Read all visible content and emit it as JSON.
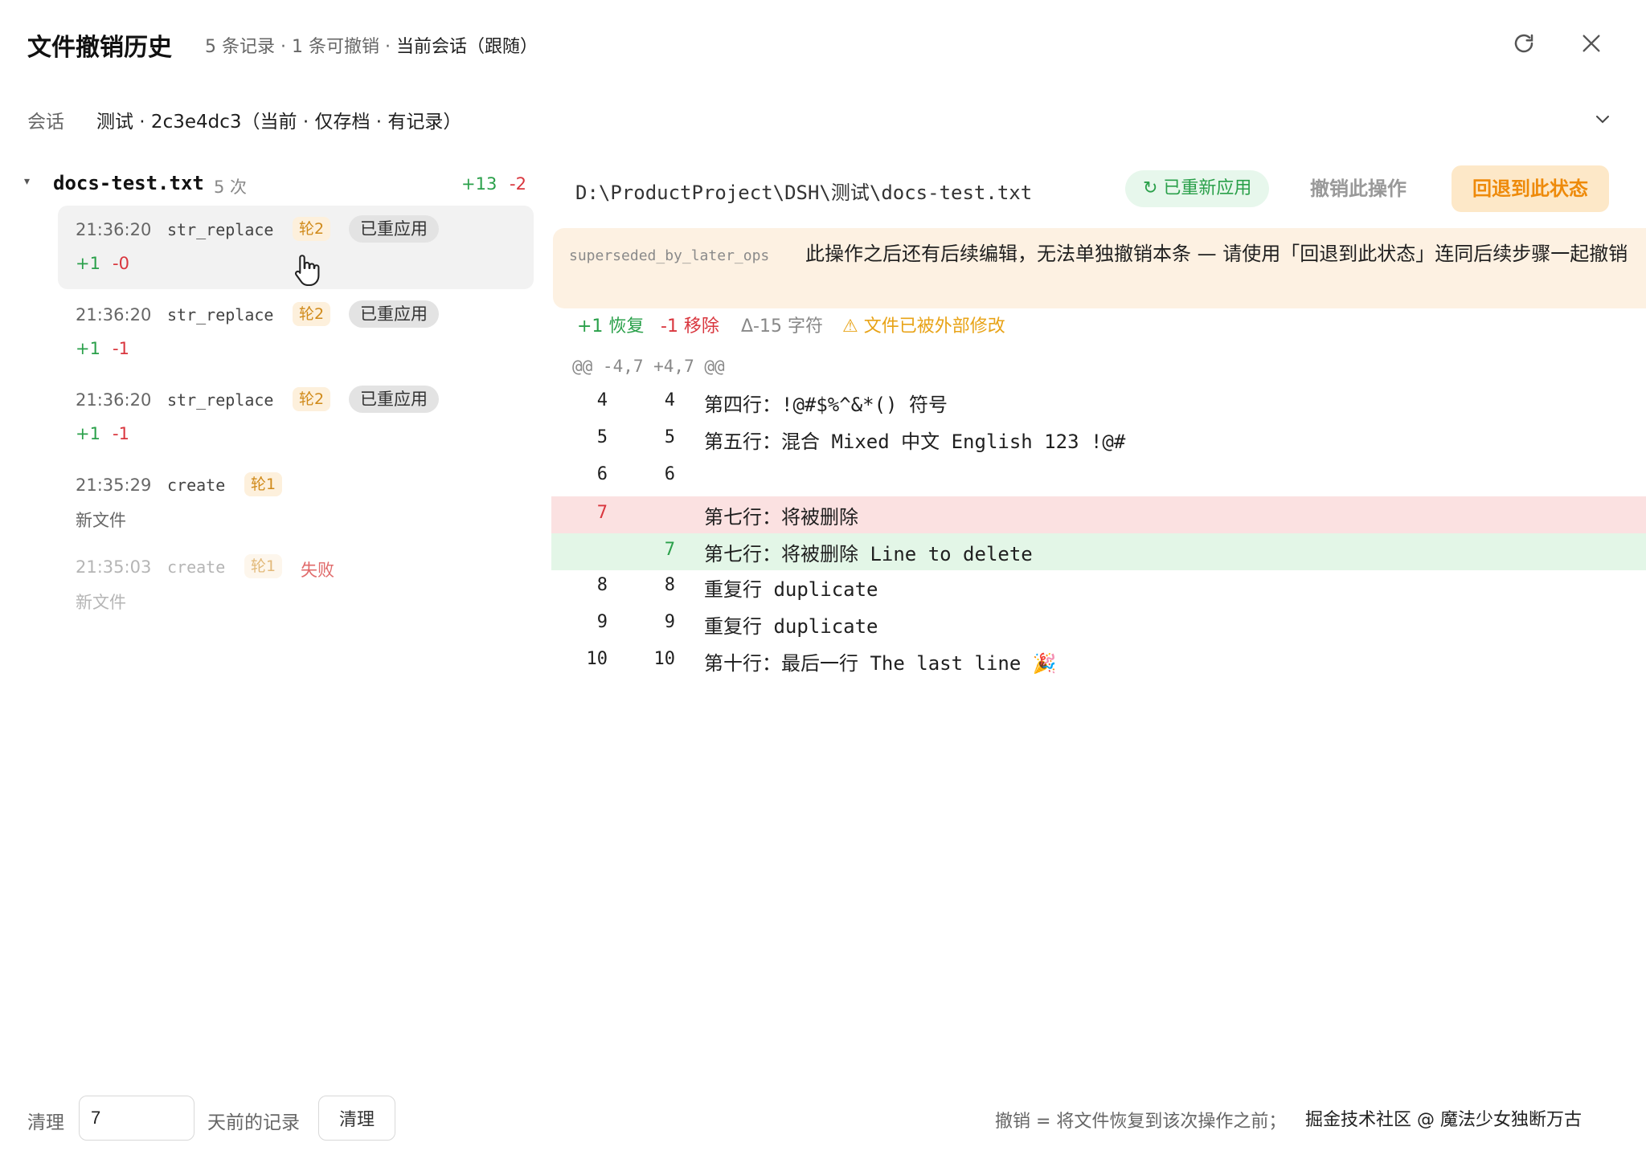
{
  "header": {
    "title": "文件撤销历史",
    "summary_plain": "5 条记录 · 1 条可撤销 · ",
    "summary_strong": "当前会话（跟随）",
    "refresh_icon": "refresh-icon",
    "close_icon": "close-icon"
  },
  "session": {
    "label": "会话",
    "value": "测试 · 2c3e4dc3（当前 · 仅存档 · 有记录）",
    "chevron_icon": "chevron-down-icon"
  },
  "file": {
    "name": "docs-test.txt",
    "count": "5 次",
    "added": "+13",
    "removed": "-2",
    "entries": [
      {
        "time": "21:36:20",
        "op": "str_replace",
        "round": "轮2",
        "status": "已重应用",
        "plus": "+1",
        "minus": "-0"
      },
      {
        "time": "21:36:20",
        "op": "str_replace",
        "round": "轮2",
        "status": "已重应用",
        "plus": "+1",
        "minus": "-1"
      },
      {
        "time": "21:36:20",
        "op": "str_replace",
        "round": "轮2",
        "status": "已重应用",
        "plus": "+1",
        "minus": "-1"
      },
      {
        "time": "21:35:29",
        "op": "create",
        "round": "轮1",
        "note": "新文件"
      },
      {
        "time": "21:35:03",
        "op": "create",
        "round": "轮1",
        "fail": "失败",
        "note": "新文件"
      }
    ]
  },
  "detail": {
    "path": "D:\\ProductProject\\DSH\\测试\\docs-test.txt",
    "reapplied_badge": "↻ 已重新应用",
    "undo_button": "撤销此操作",
    "rollback_button": "回退到此状态",
    "warn_code": "superseded_by_later_ops",
    "warn_text": "此操作之后还有后续编辑，无法单独撤销本条 — 请使用「回退到此状态」连同后续步骤一起撤销",
    "stats": {
      "restore": "+1 恢复",
      "remove": "-1 移除",
      "delta": "Δ-15 字符",
      "external": "⚠ 文件已被外部修改"
    },
    "hunk": "@@ -4,7 +4,7 @@",
    "lines": [
      {
        "old": "4",
        "new": "4",
        "text": "第四行：!@#$%^&*() 符号"
      },
      {
        "old": "5",
        "new": "5",
        "text": "第五行：混合 Mixed 中文 English 123 !@#"
      },
      {
        "old": "6",
        "new": "6",
        "text": ""
      },
      {
        "old": "7",
        "new": "",
        "text": "第七行：将被删除"
      },
      {
        "old": "",
        "new": "7",
        "text": "第七行：将被删除 Line to delete"
      },
      {
        "old": "8",
        "new": "8",
        "text": "重复行 duplicate"
      },
      {
        "old": "9",
        "new": "9",
        "text": "重复行 duplicate"
      },
      {
        "old": "10",
        "new": "10",
        "text": "第十行：最后一行 The last line 🎉"
      }
    ]
  },
  "footer": {
    "label": "清理",
    "days_value": "7",
    "after_label": "天前的记录",
    "button": "清理",
    "hint": "撤销 = 将文件恢复到该次操作之前；",
    "watermark": "掘金技术社区 @ 魔法少女独断万古"
  },
  "colors": {
    "add": "#2aa04a",
    "del": "#d9363e",
    "accent_orange": "#ee8a0a",
    "warn_bg": "#fdf1e2"
  }
}
